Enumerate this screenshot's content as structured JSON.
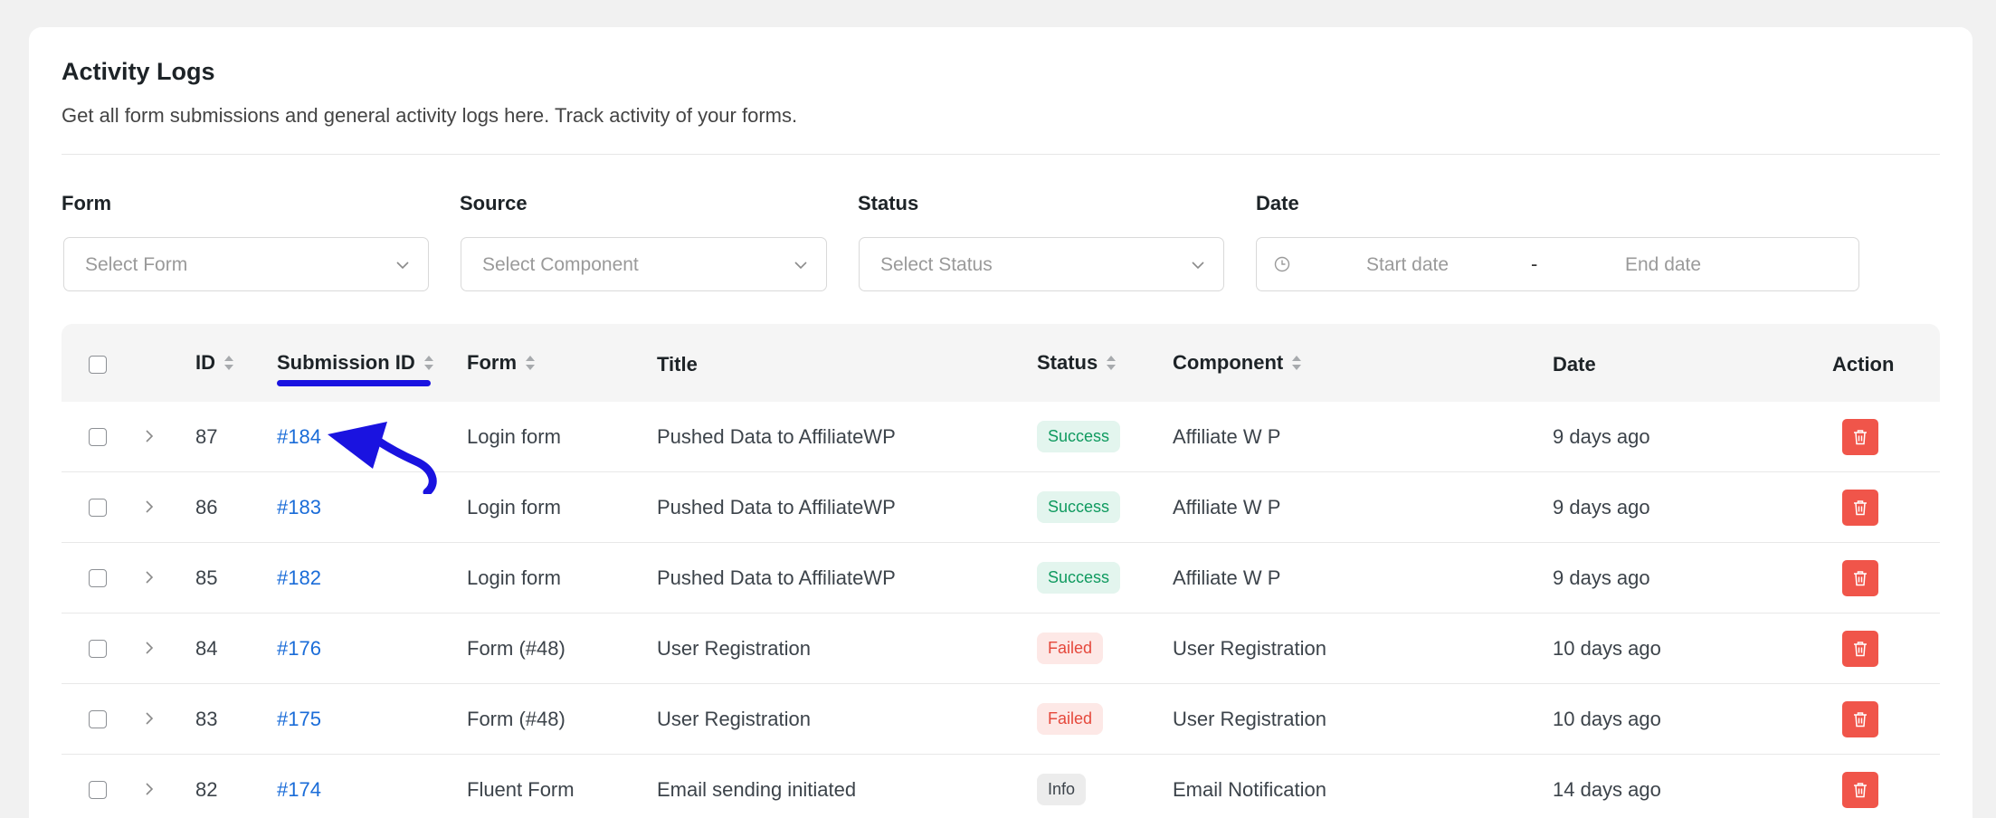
{
  "page": {
    "title": "Activity Logs",
    "subtitle": "Get all form submissions and general activity logs here. Track activity of your forms."
  },
  "filters": {
    "form": {
      "label": "Form",
      "placeholder": "Select Form"
    },
    "source": {
      "label": "Source",
      "placeholder": "Select Component"
    },
    "status": {
      "label": "Status",
      "placeholder": "Select Status"
    },
    "date": {
      "label": "Date",
      "start_placeholder": "Start date",
      "separator": "-",
      "end_placeholder": "End date"
    }
  },
  "table": {
    "columns": {
      "id": "ID",
      "submission_id": "Submission ID",
      "form": "Form",
      "title": "Title",
      "status": "Status",
      "component": "Component",
      "date": "Date",
      "action": "Action"
    },
    "rows": [
      {
        "id": "87",
        "submission": "#184",
        "form": "Login form",
        "title": "Pushed Data to AffiliateWP",
        "status": "Success",
        "status_type": "success",
        "component": "Affiliate W P",
        "date": "9 days ago"
      },
      {
        "id": "86",
        "submission": "#183",
        "form": "Login form",
        "title": "Pushed Data to AffiliateWP",
        "status": "Success",
        "status_type": "success",
        "component": "Affiliate W P",
        "date": "9 days ago"
      },
      {
        "id": "85",
        "submission": "#182",
        "form": "Login form",
        "title": "Pushed Data to AffiliateWP",
        "status": "Success",
        "status_type": "success",
        "component": "Affiliate W P",
        "date": "9 days ago"
      },
      {
        "id": "84",
        "submission": "#176",
        "form": "Form (#48)",
        "title": "User Registration",
        "status": "Failed",
        "status_type": "failed",
        "component": "User Registration",
        "date": "10 days ago"
      },
      {
        "id": "83",
        "submission": "#175",
        "form": "Form (#48)",
        "title": "User Registration",
        "status": "Failed",
        "status_type": "failed",
        "component": "User Registration",
        "date": "10 days ago"
      },
      {
        "id": "82",
        "submission": "#174",
        "form": "Fluent Form",
        "title": "Email sending initiated",
        "status": "Info",
        "status_type": "info",
        "component": "Email Notification",
        "date": "14 days ago"
      }
    ]
  },
  "icons": {
    "dropdown": "chevron-down-icon",
    "date": "clock-icon",
    "sort": "sort-icon",
    "expand": "chevron-right-icon",
    "delete": "trash-icon",
    "annotation": "arrow-annotation-icon"
  },
  "colors": {
    "link": "#1a6cd8",
    "success": "#0f9a5f",
    "failed": "#e5483c",
    "delete_button": "#f0554a",
    "annotation": "#1a13e0"
  }
}
